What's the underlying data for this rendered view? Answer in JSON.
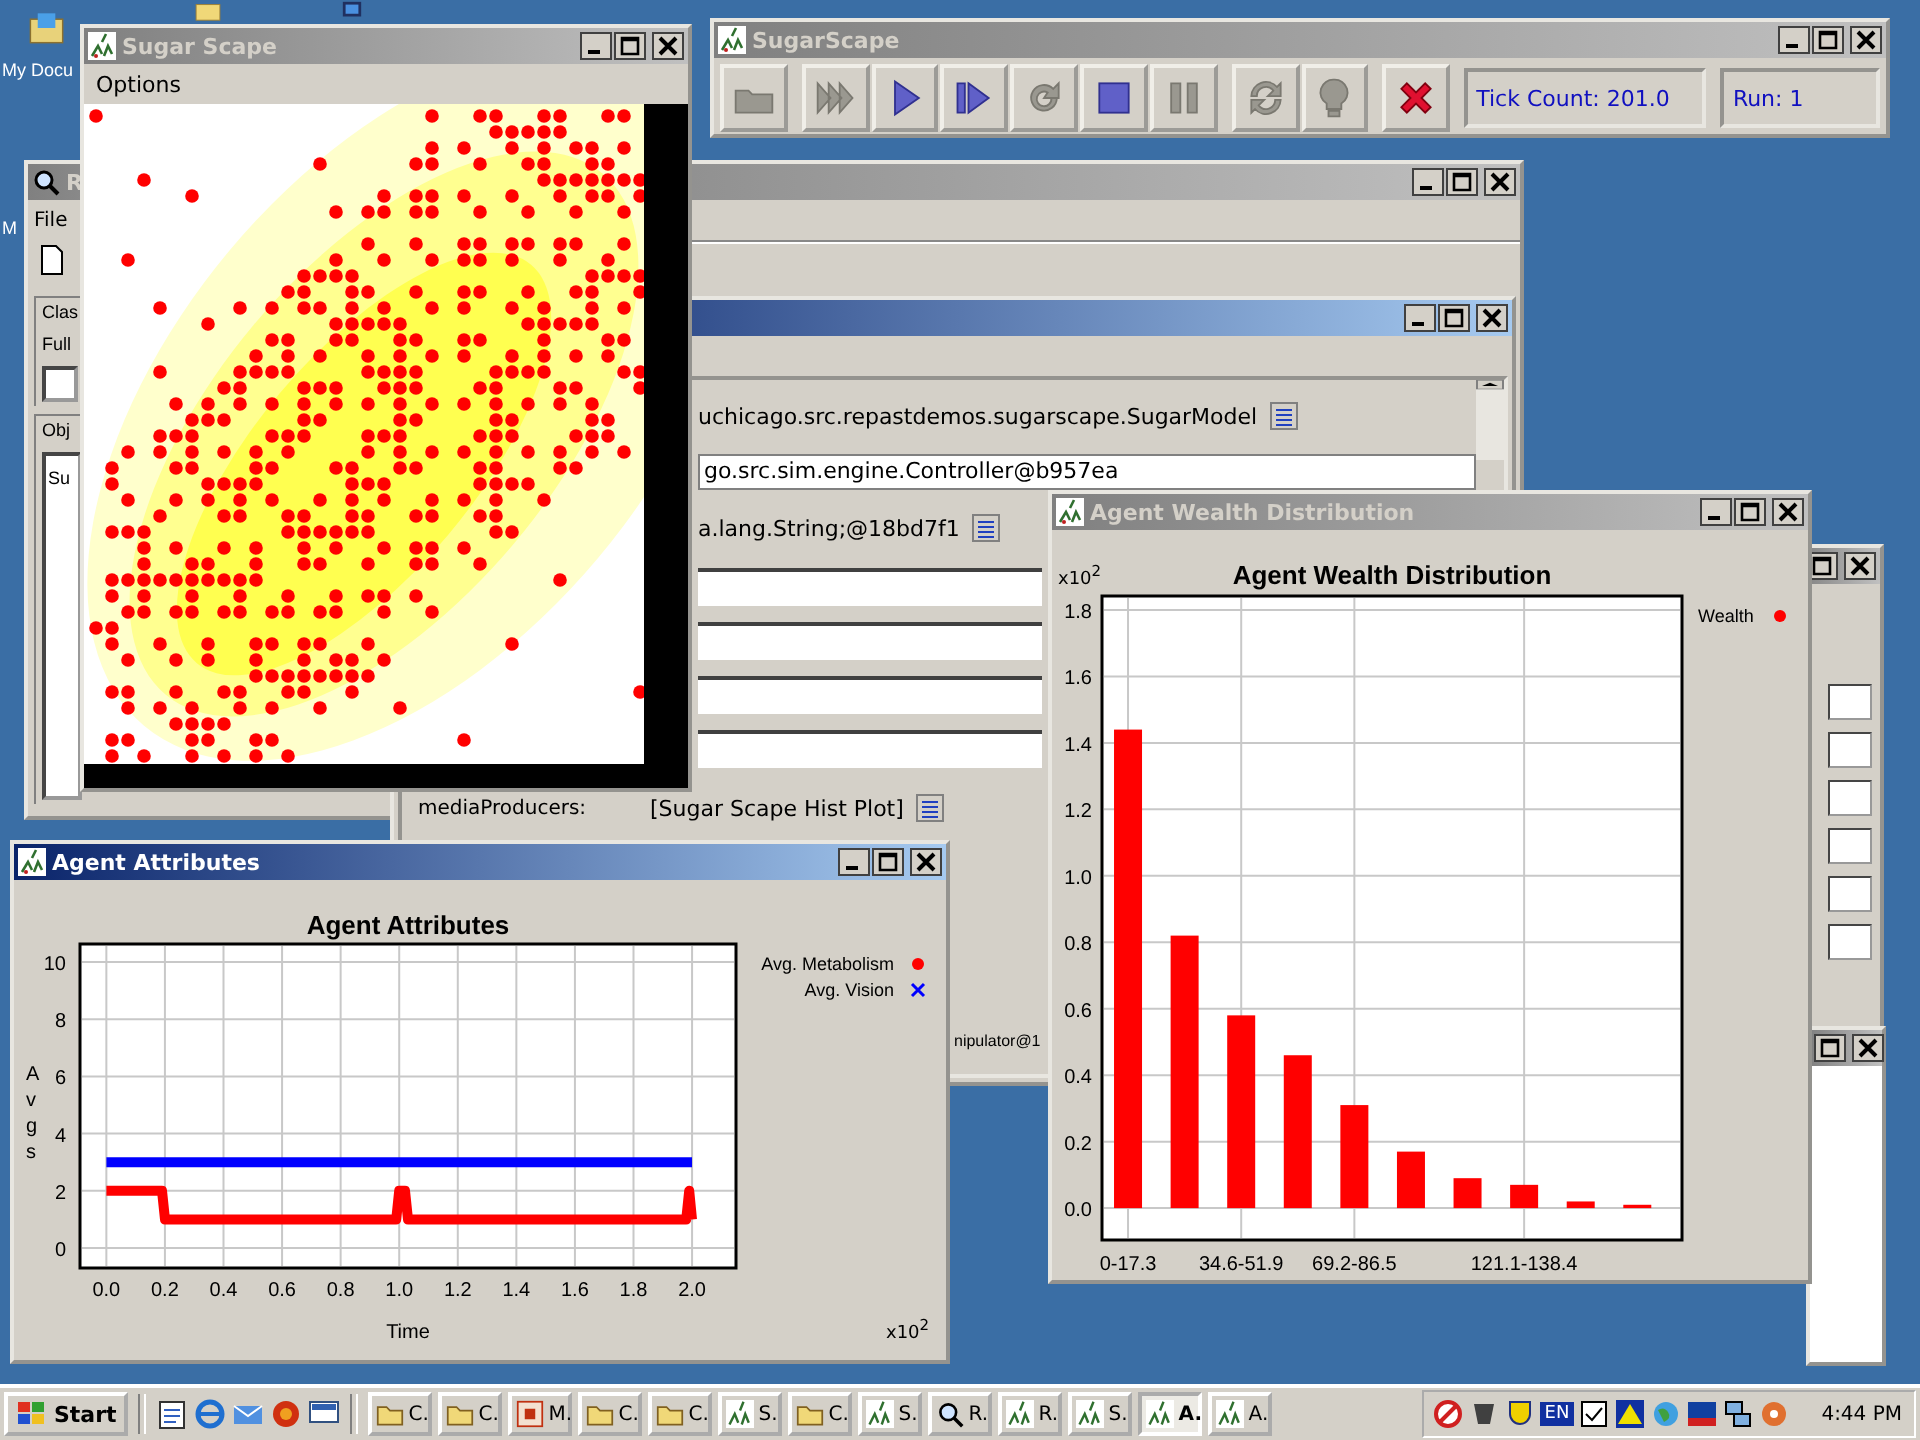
{
  "desktop": {
    "icons": [
      {
        "label": "My Docu"
      },
      {
        "label": "M"
      }
    ]
  },
  "repast_window": {
    "title": "R",
    "active": false,
    "menu": [
      "File"
    ],
    "labels": [
      "Clas",
      "Full",
      "Obj",
      "Su"
    ]
  },
  "properties_window": {
    "active": true,
    "rows": [
      {
        "kind": "list",
        "value": "uchicago.src.repastdemos.sugarscape.SugarModel"
      },
      {
        "kind": "field",
        "value": "go.src.sim.engine.Controller@b957ea"
      },
      {
        "kind": "list",
        "value": "a.lang.String;@18bd7f1"
      },
      {
        "kind": "blank"
      },
      {
        "kind": "blank"
      },
      {
        "kind": "blank"
      },
      {
        "kind": "blank"
      },
      {
        "kind": "list",
        "label": "mediaProducers:",
        "value": "[Sugar Scape  Hist  Plot]"
      },
      {
        "kind": "plain",
        "value": "nipulator@1"
      }
    ]
  },
  "sugar_scape_window": {
    "title": "Sugar Scape",
    "active": false,
    "menu": [
      "Options"
    ]
  },
  "control_window": {
    "title": "SugarScape",
    "active": false,
    "buttons": [
      {
        "kind": "open",
        "disabled": true
      },
      {
        "kind": "fast",
        "disabled": true
      },
      {
        "kind": "play",
        "disabled": false
      },
      {
        "kind": "step",
        "disabled": false
      },
      {
        "kind": "reload",
        "disabled": true
      },
      {
        "kind": "stop",
        "disabled": false
      },
      {
        "kind": "pause",
        "disabled": true
      },
      {
        "kind": "refresh",
        "disabled": true
      },
      {
        "kind": "bulb",
        "disabled": true
      },
      {
        "kind": "exit",
        "disabled": false
      }
    ],
    "tick_count": "Tick Count: 201.0",
    "run": "Run: 1"
  },
  "attributes_window": {
    "title": "Agent Attributes",
    "active": true,
    "chart_data": {
      "type": "line",
      "title": "Agent Attributes",
      "xlabel": "Time",
      "ylabel": "Avgs",
      "x": [
        0,
        0.19,
        0.2,
        0.99,
        1.0,
        1.02,
        1.03,
        1.98,
        1.99,
        2.0
      ],
      "series": [
        {
          "name": "Avg. Metabolism",
          "color": "#ff0000",
          "values": [
            2,
            2,
            1,
            1,
            2,
            2,
            1,
            1,
            2,
            1
          ]
        },
        {
          "name": "Avg. Vision",
          "color": "#0000ff",
          "values": [
            3,
            3,
            3,
            3,
            3,
            3,
            3,
            3,
            3,
            3
          ]
        }
      ],
      "xlim": [
        -0.09,
        2.15
      ],
      "ylim": [
        -0.7,
        10.63
      ],
      "xticks": [
        {
          "value": 0,
          "label": "0.0"
        },
        {
          "value": 0.2,
          "label": "0.2"
        },
        {
          "value": 0.4,
          "label": "0.4"
        },
        {
          "value": 0.6,
          "label": "0.6"
        },
        {
          "value": 0.8,
          "label": "0.8"
        },
        {
          "value": 1.0,
          "label": "1.0"
        },
        {
          "value": 1.2,
          "label": "1.2"
        },
        {
          "value": 1.4,
          "label": "1.4"
        },
        {
          "value": 1.6,
          "label": "1.6"
        },
        {
          "value": 1.8,
          "label": "1.8"
        },
        {
          "value": 2.0,
          "label": "2.0"
        }
      ],
      "yticks": [
        0,
        2,
        4,
        6,
        8,
        10
      ],
      "grid": true,
      "legend": true,
      "annotations": [
        {
          "text": "x10$^{2}$"
        }
      ]
    }
  },
  "wealth_window": {
    "title": "Agent Wealth Distribution",
    "active": false,
    "chart_data": {
      "type": "bar",
      "title": "Agent Wealth Distribution",
      "categories": [
        "0-17.3",
        null,
        "34.6-51.9",
        null,
        "69.2-86.5",
        null,
        null,
        "121.1-138.4",
        null,
        null
      ],
      "series": [
        {
          "name": "Wealth",
          "color": "#ff0000",
          "values": [
            1.44,
            0.82,
            0.58,
            0.46,
            0.31,
            0.17,
            0.09,
            0.07,
            0.02,
            0.01
          ]
        }
      ],
      "ylim": [
        -0.096,
        1.842
      ],
      "yticks": [
        {
          "value": 0,
          "label": "0.0"
        },
        {
          "value": 0.2,
          "label": "0.2"
        },
        {
          "value": 0.4,
          "label": "0.4"
        },
        {
          "value": 0.6,
          "label": "0.6"
        },
        {
          "value": 0.8,
          "label": "0.8"
        },
        {
          "value": 1.0,
          "label": "1.0"
        },
        {
          "value": 1.2,
          "label": "1.2"
        },
        {
          "value": 1.4,
          "label": "1.4"
        },
        {
          "value": 1.6,
          "label": "1.6"
        },
        {
          "value": 1.8,
          "label": "1.8"
        }
      ],
      "grid": true,
      "legend": true,
      "annotations": [
        {
          "text": "x10$^{2}$"
        }
      ]
    }
  },
  "taskbar": {
    "start": "Start",
    "tasks": [
      {
        "kind": "folder",
        "label": "C.",
        "selected": false
      },
      {
        "kind": "folder",
        "label": "C.",
        "selected": false
      },
      {
        "kind": "app",
        "label": "M.",
        "selected": false
      },
      {
        "kind": "folder",
        "label": "C.",
        "selected": false
      },
      {
        "kind": "folder",
        "label": "C.",
        "selected": false
      },
      {
        "kind": "repast",
        "label": "S.",
        "selected": false
      },
      {
        "kind": "folder",
        "label": "C.",
        "selected": false
      },
      {
        "kind": "repast",
        "label": "S.",
        "selected": false
      },
      {
        "kind": "search",
        "label": "R.",
        "selected": false
      },
      {
        "kind": "repast",
        "label": "R.",
        "selected": false
      },
      {
        "kind": "repast",
        "label": "S.",
        "selected": false
      },
      {
        "kind": "repast",
        "label": "A.",
        "selected": true
      },
      {
        "kind": "repast",
        "label": "A.",
        "selected": false
      }
    ],
    "language": "EN",
    "clock": "4:44 PM"
  }
}
